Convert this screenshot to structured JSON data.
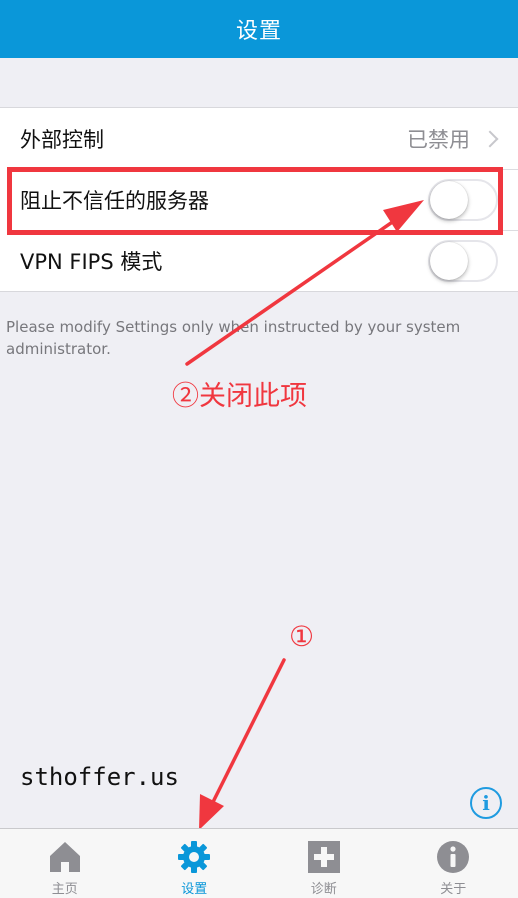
{
  "nav": {
    "title": "设置"
  },
  "settings": {
    "external_control": {
      "label": "外部控制",
      "value": "已禁用"
    },
    "block_untrusted": {
      "label": "阻止不信任的服务器",
      "enabled": false
    },
    "vpn_fips": {
      "label": "VPN FIPS 模式",
      "enabled": false
    }
  },
  "footer": {
    "note": "Please modify Settings only when instructed by your system administrator."
  },
  "annotations": {
    "step2": "②关闭此项",
    "step1": "①"
  },
  "watermark": "sthoffer.us",
  "info_button": {
    "icon": "info-icon",
    "glyph": "i"
  },
  "tabs": [
    {
      "label": "主页",
      "icon": "home-icon",
      "active": false
    },
    {
      "label": "设置",
      "icon": "gear-icon",
      "active": true
    },
    {
      "label": "诊断",
      "icon": "plus-box-icon",
      "active": false
    },
    {
      "label": "关于",
      "icon": "info-circle-icon",
      "active": false
    }
  ],
  "colors": {
    "accent": "#0a97d9",
    "annotation": "#f0373f",
    "tab_inactive": "#8e8e93"
  }
}
